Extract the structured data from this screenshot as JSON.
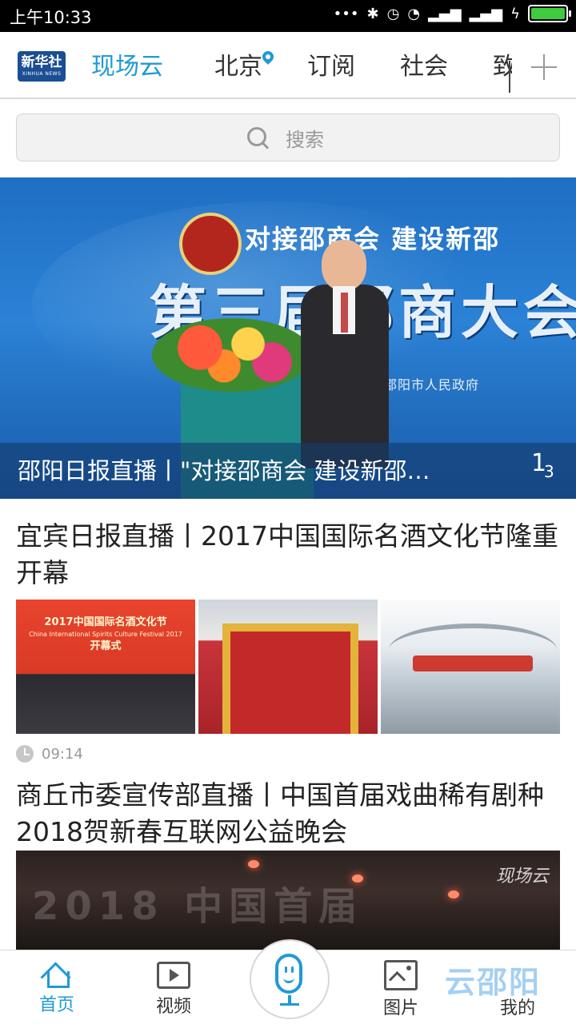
{
  "status_bar": {
    "time": "上午10:33",
    "dots": "•••"
  },
  "top_nav": {
    "logo_line1": "新华社",
    "logo_line2": "XINHUA NEWS",
    "tabs": [
      {
        "label": "现场云",
        "active": true
      },
      {
        "label": "北京",
        "active": false
      },
      {
        "label": "订阅",
        "active": false
      },
      {
        "label": "社会",
        "active": false
      },
      {
        "label": "致",
        "active": false
      }
    ]
  },
  "search": {
    "placeholder": "搜索"
  },
  "banner": {
    "headline_top": "对接邵商会  建设新邵",
    "headline_big": "第三届邵商大会",
    "organizer": "邵阳市人民政府",
    "caption": "邵阳日报直播丨\"对接邵商会 建设新邵…",
    "pager_current": "1",
    "pager_total": "3"
  },
  "articles": [
    {
      "title": "宜宾日报直播丨2017中国国际名酒文化节隆重开幕",
      "thumb_text": "2017中国国际名酒文化节",
      "thumb_sub": "China International Spirits Culture Festival 2017",
      "thumb_sub2": "开幕式",
      "time": "09:14"
    },
    {
      "title": "商丘市委宣传部直播丨中国首届戏曲稀有剧种2018贺新春互联网公益晚会",
      "watermark": "现场云",
      "video_text": "2018 中国首届"
    }
  ],
  "bottom_nav": {
    "items": [
      {
        "label": "首页",
        "icon": "home-icon",
        "active": true
      },
      {
        "label": "视频",
        "icon": "video-icon",
        "active": false
      },
      {
        "label": "",
        "icon": "mic-icon",
        "active": false
      },
      {
        "label": "图片",
        "icon": "image-icon",
        "active": false
      },
      {
        "label": "我的",
        "icon": "user-icon",
        "active": false
      }
    ],
    "watermark": "云邵阳"
  },
  "colors": {
    "accent": "#1f9ad6",
    "logo_bg": "#1b4e92"
  }
}
